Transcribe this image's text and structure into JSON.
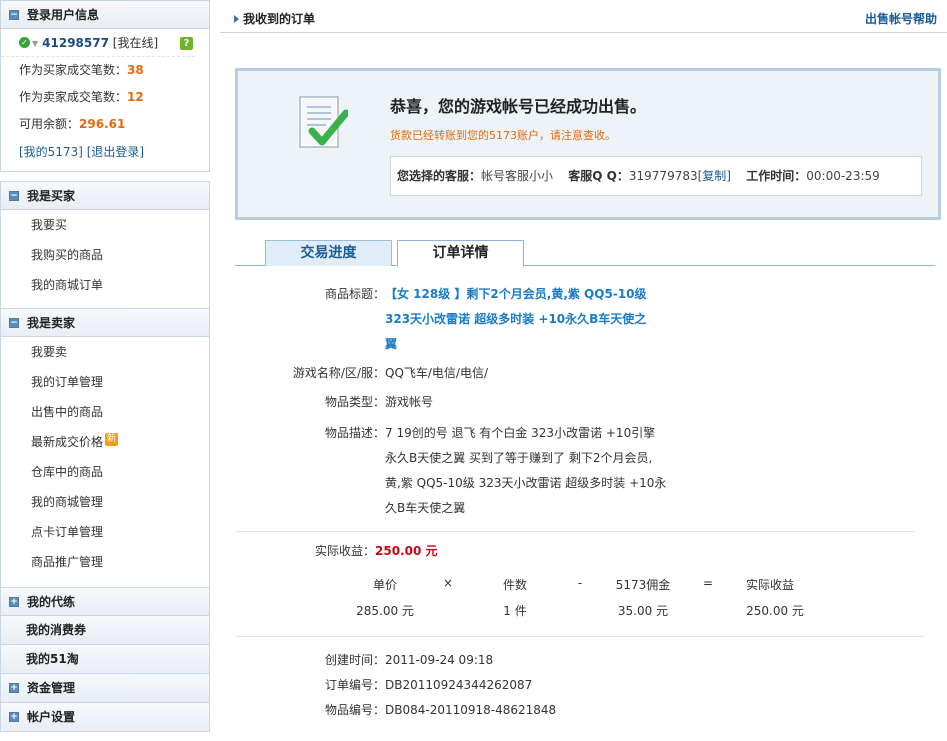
{
  "sidebar": {
    "login": {
      "title": "登录用户信息",
      "user_id": "41298577",
      "status": "[我在线]",
      "help_icon": "?",
      "buyer_label": "作为买家成交笔数：",
      "buyer_count": "38",
      "seller_label": "作为卖家成交笔数：",
      "seller_count": "12",
      "balance_label": "可用余额：",
      "balance": "296.61",
      "my_link": "[我的5173]",
      "logout_link": "[退出登录]"
    },
    "buyer": {
      "title": "我是买家",
      "items": [
        "我要买",
        "我购买的商品",
        "我的商城订单"
      ]
    },
    "seller": {
      "title": "我是卖家",
      "items": [
        "我要卖",
        "我的订单管理",
        "出售中的商品",
        "最新成交价格",
        "仓库中的商品",
        "我的商城管理",
        "点卡订单管理",
        "商品推广管理"
      ],
      "new_badge": "新"
    },
    "collapsed": [
      "我的代练",
      "我的消费券",
      "我的51淘",
      "资金管理",
      "帐户设置"
    ]
  },
  "main": {
    "title": "我收到的订单",
    "help_link": "出售帐号帮助",
    "success": {
      "title": "恭喜，您的游戏帐号已经成功出售。",
      "subtitle": "货款已经转账到您的5173账户，请注意查收。",
      "service_label": "您选择的客服：",
      "service_value": "帐号客服小小",
      "qq_label": "客服Q Q：",
      "qq_value": "319779783",
      "copy_link": "[复制]",
      "hours_label": "工作时间：",
      "hours_value": "00:00-23:59"
    },
    "tabs": [
      "交易进度",
      "订单详情"
    ],
    "detail": {
      "title_label": "商品标题：",
      "title_lines": [
        "【女  128级  】剩下2个月会员,黄,紫  QQ5-10级",
        "323天小改雷诺  超级多时装  +10永久B车天使之",
        "翼"
      ],
      "game_label": "游戏名称/区/服：",
      "game_value": "QQ飞车/电信/电信/",
      "type_label": "物品类型：",
      "type_value": "游戏帐号",
      "desc_label": "物品描述：",
      "desc_lines": [
        "7 19创的号  退飞  有个白金  323小改雷诺  +10引擎",
        "永久B天使之翼  买到了等于赚到了  剩下2个月会员,",
        "黄,紫  QQ5-10级  323天小改雷诺  超级多时装  +10永",
        "久B车天使之翼"
      ],
      "income_label": "实际收益：",
      "income_value": "250.00 元"
    },
    "calc": {
      "headers": [
        "单价",
        "×",
        "件数",
        "-",
        "5173佣金",
        "=",
        "实际收益"
      ],
      "values": [
        "285.00 元",
        "1 件",
        "35.00 元",
        "250.00 元"
      ]
    },
    "meta": {
      "created_label": "创建时间：",
      "created_value": "2011-09-24 09:18",
      "order_label": "订单编号：",
      "order_value": "DB20110924344262087",
      "item_label": "物品编号：",
      "item_value": "DB084-20110918-48621848"
    }
  }
}
